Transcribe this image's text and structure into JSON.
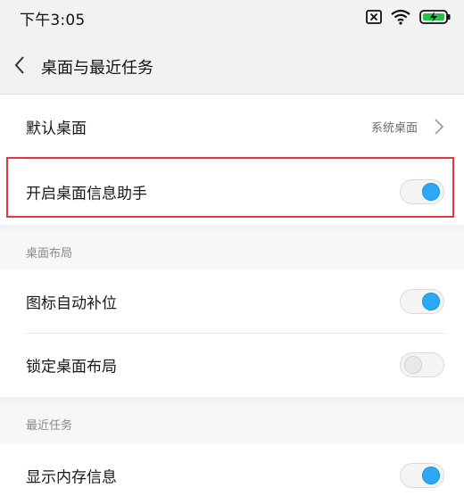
{
  "status_bar": {
    "time": "下午3:05",
    "icons": [
      "sim-card-disabled-icon",
      "wifi-icon",
      "battery-charging-icon"
    ]
  },
  "header": {
    "back_icon": "chevron-left-icon",
    "title": "桌面与最近任务"
  },
  "rows": {
    "default_launcher": {
      "label": "默认桌面",
      "value": "系统桌面"
    },
    "launcher_assistant": {
      "label": "开启桌面信息助手",
      "enabled": true
    },
    "auto_fill_icons": {
      "label": "图标自动补位",
      "enabled": true
    },
    "lock_layout": {
      "label": "锁定桌面布局",
      "enabled": false
    },
    "show_memory": {
      "label": "显示内存信息",
      "enabled": true
    }
  },
  "sections": {
    "layout": "桌面布局",
    "recents": "最近任务"
  },
  "colors": {
    "toggle_on": "#2da8f5",
    "highlight": "#e0393b",
    "background": "#f2f2f2"
  }
}
